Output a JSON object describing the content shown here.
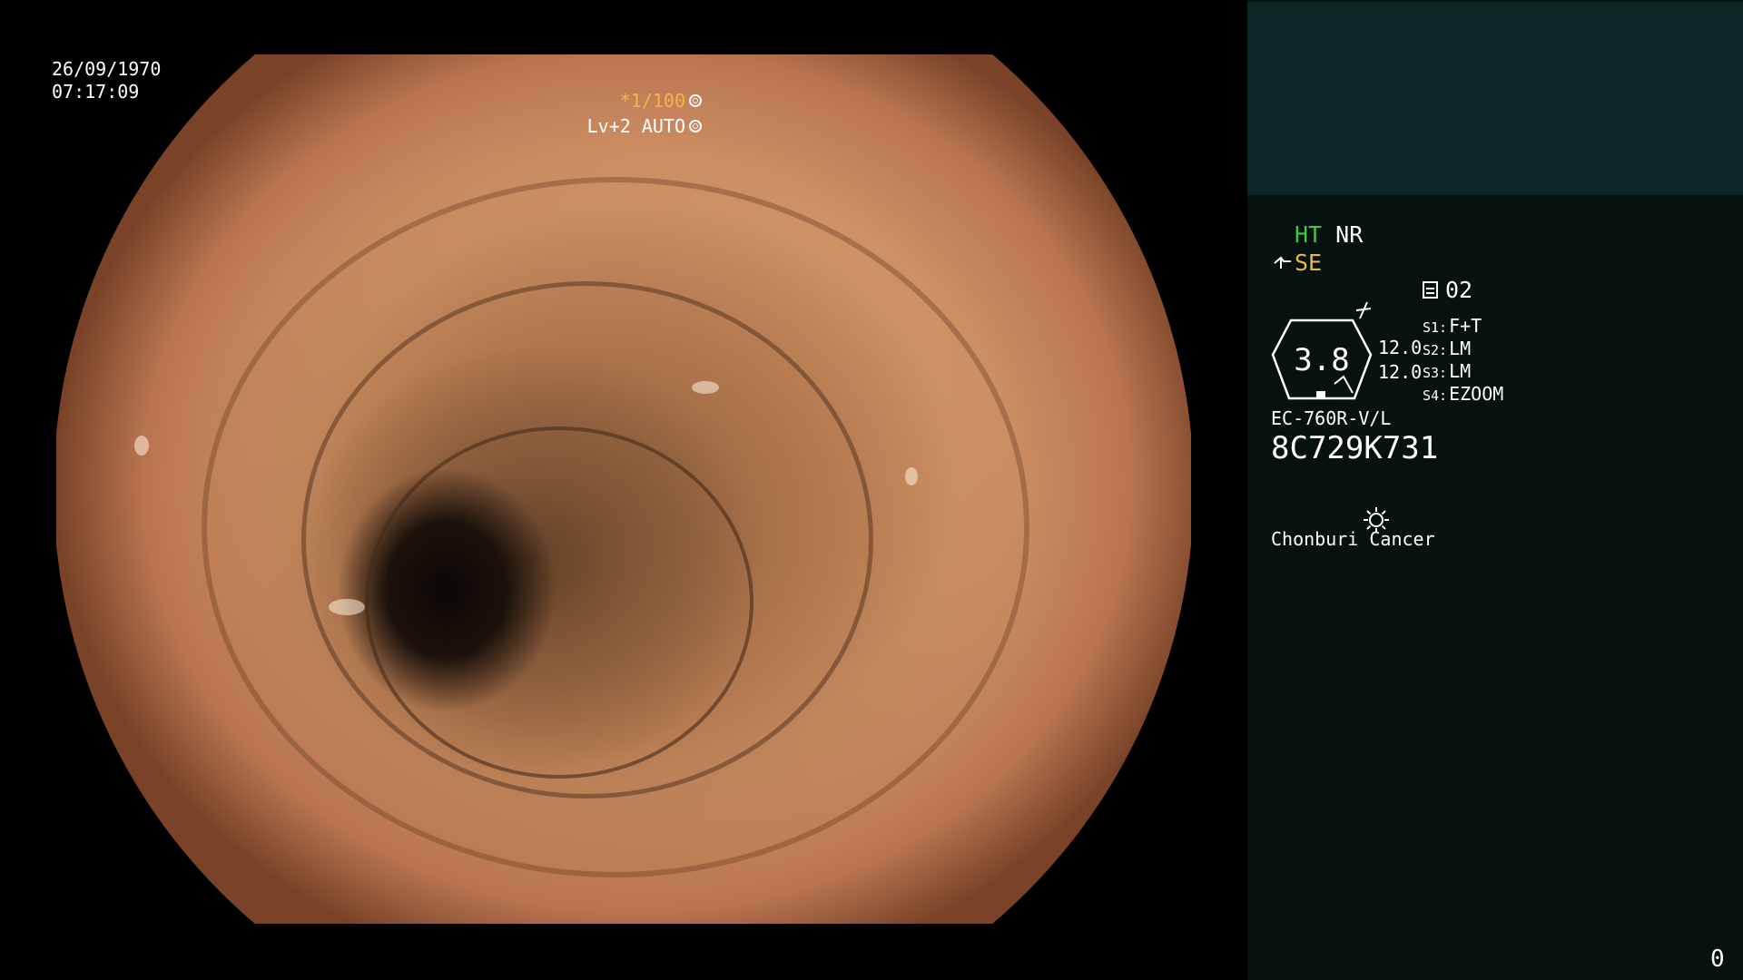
{
  "overlay": {
    "date": "26/09/1970",
    "time": "07:17:09",
    "shutter": "*1/100",
    "level": "Lv+2 AUTO"
  },
  "panel": {
    "ht_label": "HT",
    "nr_label": "NR",
    "se_label": "SE",
    "record_number": "02",
    "gauge_value": "3.8",
    "gauge_readings": [
      "12.0",
      "12.0"
    ],
    "switches": [
      {
        "key": "S1:",
        "value": "F+T"
      },
      {
        "key": "S2:",
        "value": "LM"
      },
      {
        "key": "S3:",
        "value": "LM"
      },
      {
        "key": "S4:",
        "value": "EZOOM"
      }
    ],
    "scope_model": "EC-760R-V/L",
    "serial_number": "8C729K731",
    "hospital": "Chonburi Cancer",
    "page_counter": "0"
  },
  "icons": {
    "shutter": "aperture-icon",
    "level": "iris-icon",
    "se": "scope-tip-icon",
    "enhance": "enhance-icon",
    "record": "record-icon",
    "light": "light-icon"
  },
  "colors": {
    "ht": "#3ec93e",
    "se": "#f2b445",
    "shutter": "#f2b445",
    "panel_bg": "#051210",
    "panel_header_bg": "#0d2524"
  }
}
